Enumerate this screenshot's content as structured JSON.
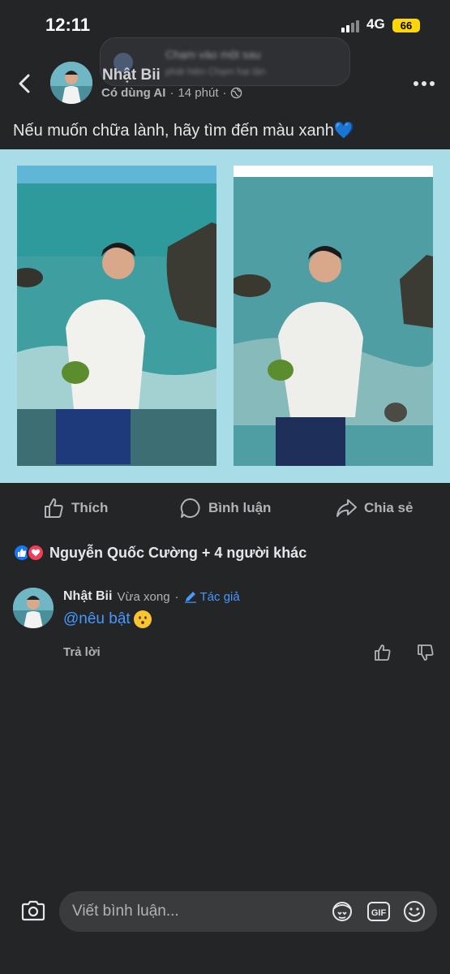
{
  "status": {
    "time": "12:11",
    "network": "4G",
    "battery": "66"
  },
  "toast": {
    "line1": "Chạm vào một sau",
    "line2": "phát hiện Chạm hai lần"
  },
  "post": {
    "author": "Nhật Bii",
    "ai_label": "Có dùng AI",
    "time": "14 phút",
    "separator": "·",
    "caption": "Nếu muốn chữa lành, hãy tìm đến màu xanh",
    "caption_emoji": "💙"
  },
  "actions": {
    "like": "Thích",
    "comment": "Bình luận",
    "share": "Chia sẻ"
  },
  "reactions": {
    "summary": "Nguyễn Quốc Cường + 4 người khác"
  },
  "comment": {
    "author": "Nhật Bii",
    "time": "Vừa xong",
    "separator": "·",
    "badge": "Tác giả",
    "text": "@nêu bật",
    "reply": "Trả lời"
  },
  "composer": {
    "placeholder": "Viết bình luận..."
  },
  "icons": [
    "back-icon",
    "more-icon",
    "globe-icon",
    "like-icon",
    "comment-icon",
    "share-icon",
    "camera-icon",
    "avatar-sticker-icon",
    "gif-icon",
    "emoji-icon",
    "thumbs-up-icon",
    "thumbs-down-icon",
    "pencil-icon"
  ],
  "colors": {
    "background": "#242526",
    "accent": "#4599ff",
    "photo_frame": "#a8dce6",
    "like": "#1877f2",
    "love": "#f33e58"
  }
}
